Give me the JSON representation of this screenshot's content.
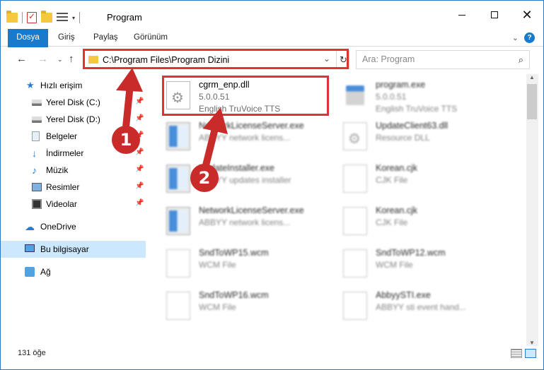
{
  "window": {
    "title": "Program",
    "controls": {
      "minimize": "–",
      "maximize": "□",
      "close": "✕"
    }
  },
  "ribbon": {
    "tabs": [
      "Dosya",
      "Giriş",
      "Paylaş",
      "Görünüm"
    ]
  },
  "address_bar": {
    "path": "C:\\Program Files\\Program Dizini",
    "dropdown_glyph": "⌄",
    "refresh_glyph": "↻"
  },
  "search": {
    "placeholder": "Ara: Program"
  },
  "sidebar": {
    "items": [
      {
        "label": "Hızlı erişim",
        "icon": "star-icon",
        "pinned": false
      },
      {
        "label": "Yerel Disk (C:)",
        "icon": "drive-icon",
        "pinned": true
      },
      {
        "label": "Yerel Disk (D:)",
        "icon": "drive-icon",
        "pinned": true
      },
      {
        "label": "Belgeler",
        "icon": "documents-icon",
        "pinned": true
      },
      {
        "label": "İndirmeler",
        "icon": "downloads-icon",
        "pinned": true
      },
      {
        "label": "Müzik",
        "icon": "music-icon",
        "pinned": true
      },
      {
        "label": "Resimler",
        "icon": "pictures-icon",
        "pinned": true
      },
      {
        "label": "Videolar",
        "icon": "videos-icon",
        "pinned": true
      },
      {
        "label": "OneDrive",
        "icon": "onedrive-icon",
        "pinned": false
      },
      {
        "label": "Bu bilgisayar",
        "icon": "this-pc-icon",
        "pinned": false
      },
      {
        "label": "Ağ",
        "icon": "network-icon",
        "pinned": false
      }
    ]
  },
  "files": [
    {
      "name": "cgrm_enp.dll",
      "version": "5.0.0.51",
      "description": "English TruVoice TTS",
      "icon": "dll-gear-icon",
      "highlighted": true
    },
    {
      "name": "program.exe",
      "version": "5.0.0.51",
      "description": "English TruVoice TTS",
      "icon": "program-icon"
    },
    {
      "name": "NetworkLicenseServer.exe",
      "description": "ABBYY network licens...",
      "icon": "exe-icon"
    },
    {
      "name": "UpdateClient63.dll",
      "description": "Resource DLL",
      "icon": "dll-gear-icon"
    },
    {
      "name": "UpdateInstaller.exe",
      "description": "ABBYY updates installer",
      "icon": "exe-icon"
    },
    {
      "name": "Korean.cjk",
      "description": "CJK File",
      "icon": "page-icon"
    },
    {
      "name": "NetworkLicenseServer.exe",
      "description": "ABBYY network licens...",
      "icon": "exe-icon"
    },
    {
      "name": "Korean.cjk",
      "description": "CJK File",
      "icon": "page-icon"
    },
    {
      "name": "SndToWP15.wcm",
      "description": "WCM File",
      "icon": "page-icon"
    },
    {
      "name": "SndToWP12.wcm",
      "description": "WCM File",
      "icon": "page-icon"
    },
    {
      "name": "SndToWP16.wcm",
      "description": "WCM File",
      "icon": "page-icon"
    },
    {
      "name": "AbbyySTI.exe",
      "description": "ABBYY sti event hand...",
      "icon": "page-icon"
    }
  ],
  "status": {
    "item_count": "131 öğe"
  },
  "callouts": [
    "1",
    "2"
  ],
  "colors": {
    "accent": "#1979ca",
    "highlight": "#d33333",
    "callout": "#c92b2b",
    "selected": "#cce8ff"
  }
}
